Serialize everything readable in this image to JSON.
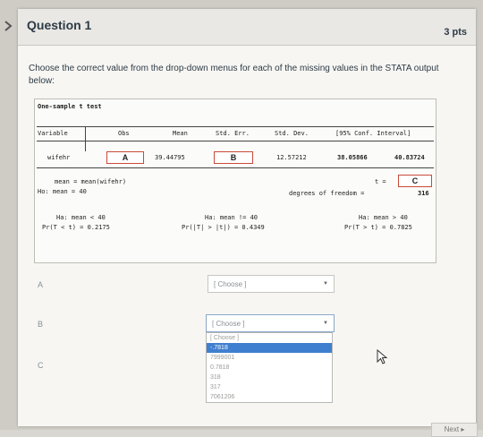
{
  "question": {
    "title": "Question 1",
    "points": "3 pts",
    "instructions": "Choose the correct value from the drop-down menus for each of the missing values in the STATA output below:"
  },
  "stata": {
    "title": "One-sample t test",
    "headers": [
      "Variable",
      "Obs",
      "Mean",
      "Std. Err.",
      "Std. Dev.",
      "[95% Conf. Interval]"
    ],
    "row": {
      "variable": "wifehr",
      "obs": "A",
      "mean": "39.44795",
      "std_err": "B",
      "std_dev": "12.57212",
      "ci_low": "38.05866",
      "ci_high": "40.83724"
    },
    "mean_line": "mean = mean(wifehr)",
    "ho_line": "Ho: mean = 40",
    "t_label": "t =",
    "t_value": "C",
    "df_label": "degrees of freedom =",
    "df_value": "316",
    "ha_left": "Ha: mean < 40",
    "ha_mid": "Ha: mean != 40",
    "ha_right": "Ha: mean > 40",
    "p_left": "Pr(T < t) = 0.2175",
    "p_mid": "Pr(|T| > |t|) = 0.4349",
    "p_right": "Pr(T > t) = 0.7825"
  },
  "answers": [
    {
      "label": "A",
      "value": "[ Choose ]"
    },
    {
      "label": "B",
      "value": "[ Choose ]"
    },
    {
      "label": "C",
      "value": ""
    }
  ],
  "dropdown_options": [
    "[ Choose ]",
    "-.7818",
    "7999001",
    "0.7818",
    "318",
    "317",
    "7061206"
  ],
  "highlighted_option": "-.7818",
  "next_button": "Next ▸"
}
